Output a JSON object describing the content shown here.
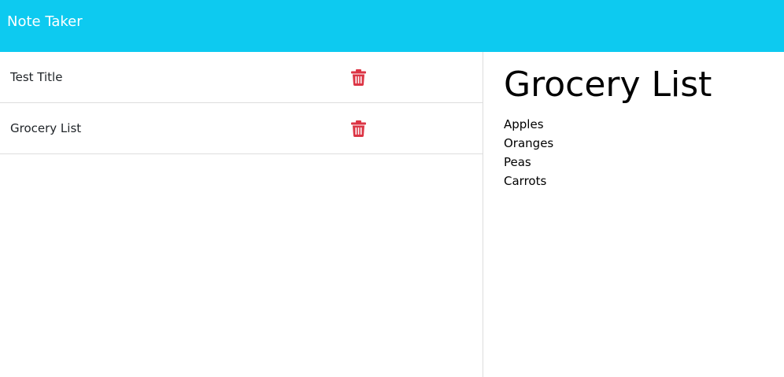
{
  "navbar": {
    "brand": "Note Taker",
    "color": "#0dcaf0"
  },
  "notes": [
    {
      "title": "Test Title",
      "delete_icon": "trash-icon"
    },
    {
      "title": "Grocery List",
      "delete_icon": "trash-icon"
    }
  ],
  "delete_icon_color": "#dc3545",
  "active_note": {
    "title": "Grocery List",
    "lines": [
      "Apples",
      "Oranges",
      "Peas",
      "Carrots"
    ]
  }
}
